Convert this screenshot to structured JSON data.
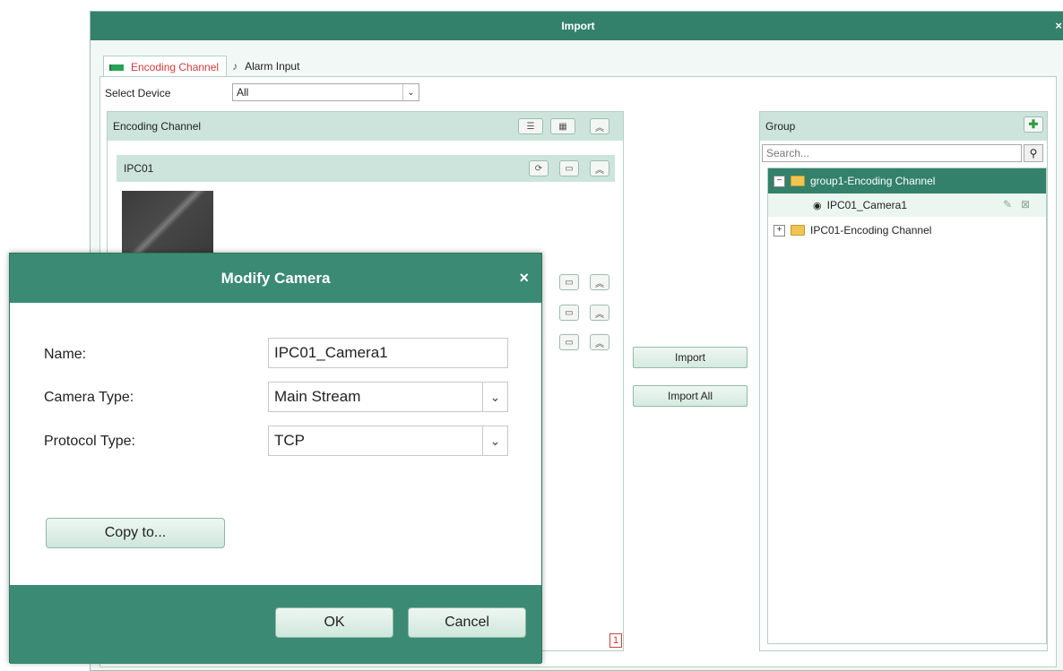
{
  "window": {
    "title": "Import",
    "close_glyph": "×"
  },
  "tabs": [
    {
      "label": "Encoding Channel",
      "icon": "camera-icon",
      "active": true
    },
    {
      "label": "Alarm Input",
      "icon": "alarm-icon",
      "active": false
    }
  ],
  "select_device": {
    "label": "Select Device",
    "value": "All"
  },
  "left_panel": {
    "title": "Encoding Channel",
    "device": {
      "name": "IPC01"
    },
    "page_number": "1"
  },
  "middle": {
    "import_label": "Import",
    "import_all_label": "Import All"
  },
  "right_panel": {
    "title": "Group",
    "search_placeholder": "Search...",
    "tree": {
      "selected_group": "group1-Encoding Channel",
      "child": "IPC01_Camera1",
      "other_group": "IPC01-Encoding Channel"
    }
  },
  "modal": {
    "title": "Modify Camera",
    "close_glyph": "×",
    "name_label": "Name:",
    "name_value": "IPC01_Camera1",
    "camera_type_label": "Camera Type:",
    "camera_type_value": "Main Stream",
    "protocol_type_label": "Protocol Type:",
    "protocol_type_value": "TCP",
    "copy_to_label": "Copy to...",
    "ok_label": "OK",
    "cancel_label": "Cancel"
  },
  "colors": {
    "header_green": "#33816a",
    "modal_green": "#3a8a74",
    "panel_header": "#cde4dc",
    "active_tab_text": "#d33a3a"
  }
}
